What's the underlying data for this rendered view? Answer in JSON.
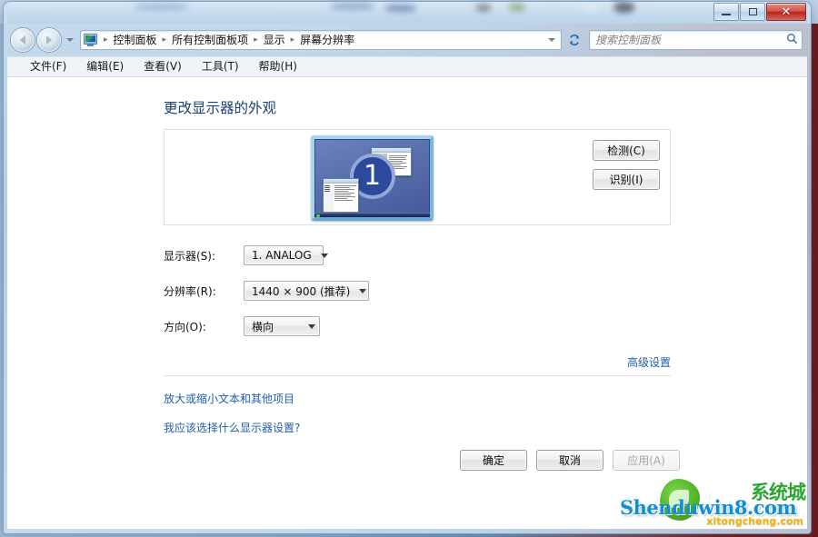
{
  "window": {
    "controls": {
      "minimize": "—",
      "maximize": "❐",
      "close": "✕"
    }
  },
  "nav": {
    "back_title": "后退",
    "forward_title": "前进",
    "history_caret": "▾",
    "refresh_icon": "refresh-icon",
    "breadcrumb_icon": "display-icon",
    "breadcrumbs": [
      "控制面板",
      "所有控制面板项",
      "显示",
      "屏幕分辨率"
    ],
    "separator": "▸",
    "address_caret": "▾"
  },
  "search": {
    "placeholder": "搜索控制面板",
    "value": "",
    "icon": "search-icon"
  },
  "menubar": {
    "items": [
      "文件(F)",
      "编辑(E)",
      "查看(V)",
      "工具(T)",
      "帮助(H)"
    ]
  },
  "main": {
    "page_title": "更改显示器的外观",
    "preview": {
      "monitor_number": "1",
      "detect_button": "检测(C)",
      "identify_button": "识别(I)"
    },
    "fields": [
      {
        "label": "显示器(S):",
        "value": "1. ANALOG",
        "name": "monitor-select"
      },
      {
        "label": "分辨率(R):",
        "value": "1440 × 900 (推荐)",
        "name": "resolution-select"
      },
      {
        "label": "方向(O):",
        "value": "横向",
        "name": "orientation-select"
      }
    ],
    "advanced_link": "高级设置",
    "links": [
      "放大或缩小文本和其他项目",
      "我应该选择什么显示器设置?"
    ],
    "buttons": {
      "ok": "确定",
      "cancel": "取消",
      "apply": "应用(A)"
    }
  },
  "watermark": {
    "cn_text": "系统城",
    "main_text": "Shenduwin8.com",
    "sub_text": "xitongcheng.com"
  },
  "colors": {
    "title_blue": "#1b3f6e",
    "link_blue": "#1f5fa8",
    "close_red": "#b5251c",
    "monitor_blue": "#2b4a9b"
  }
}
